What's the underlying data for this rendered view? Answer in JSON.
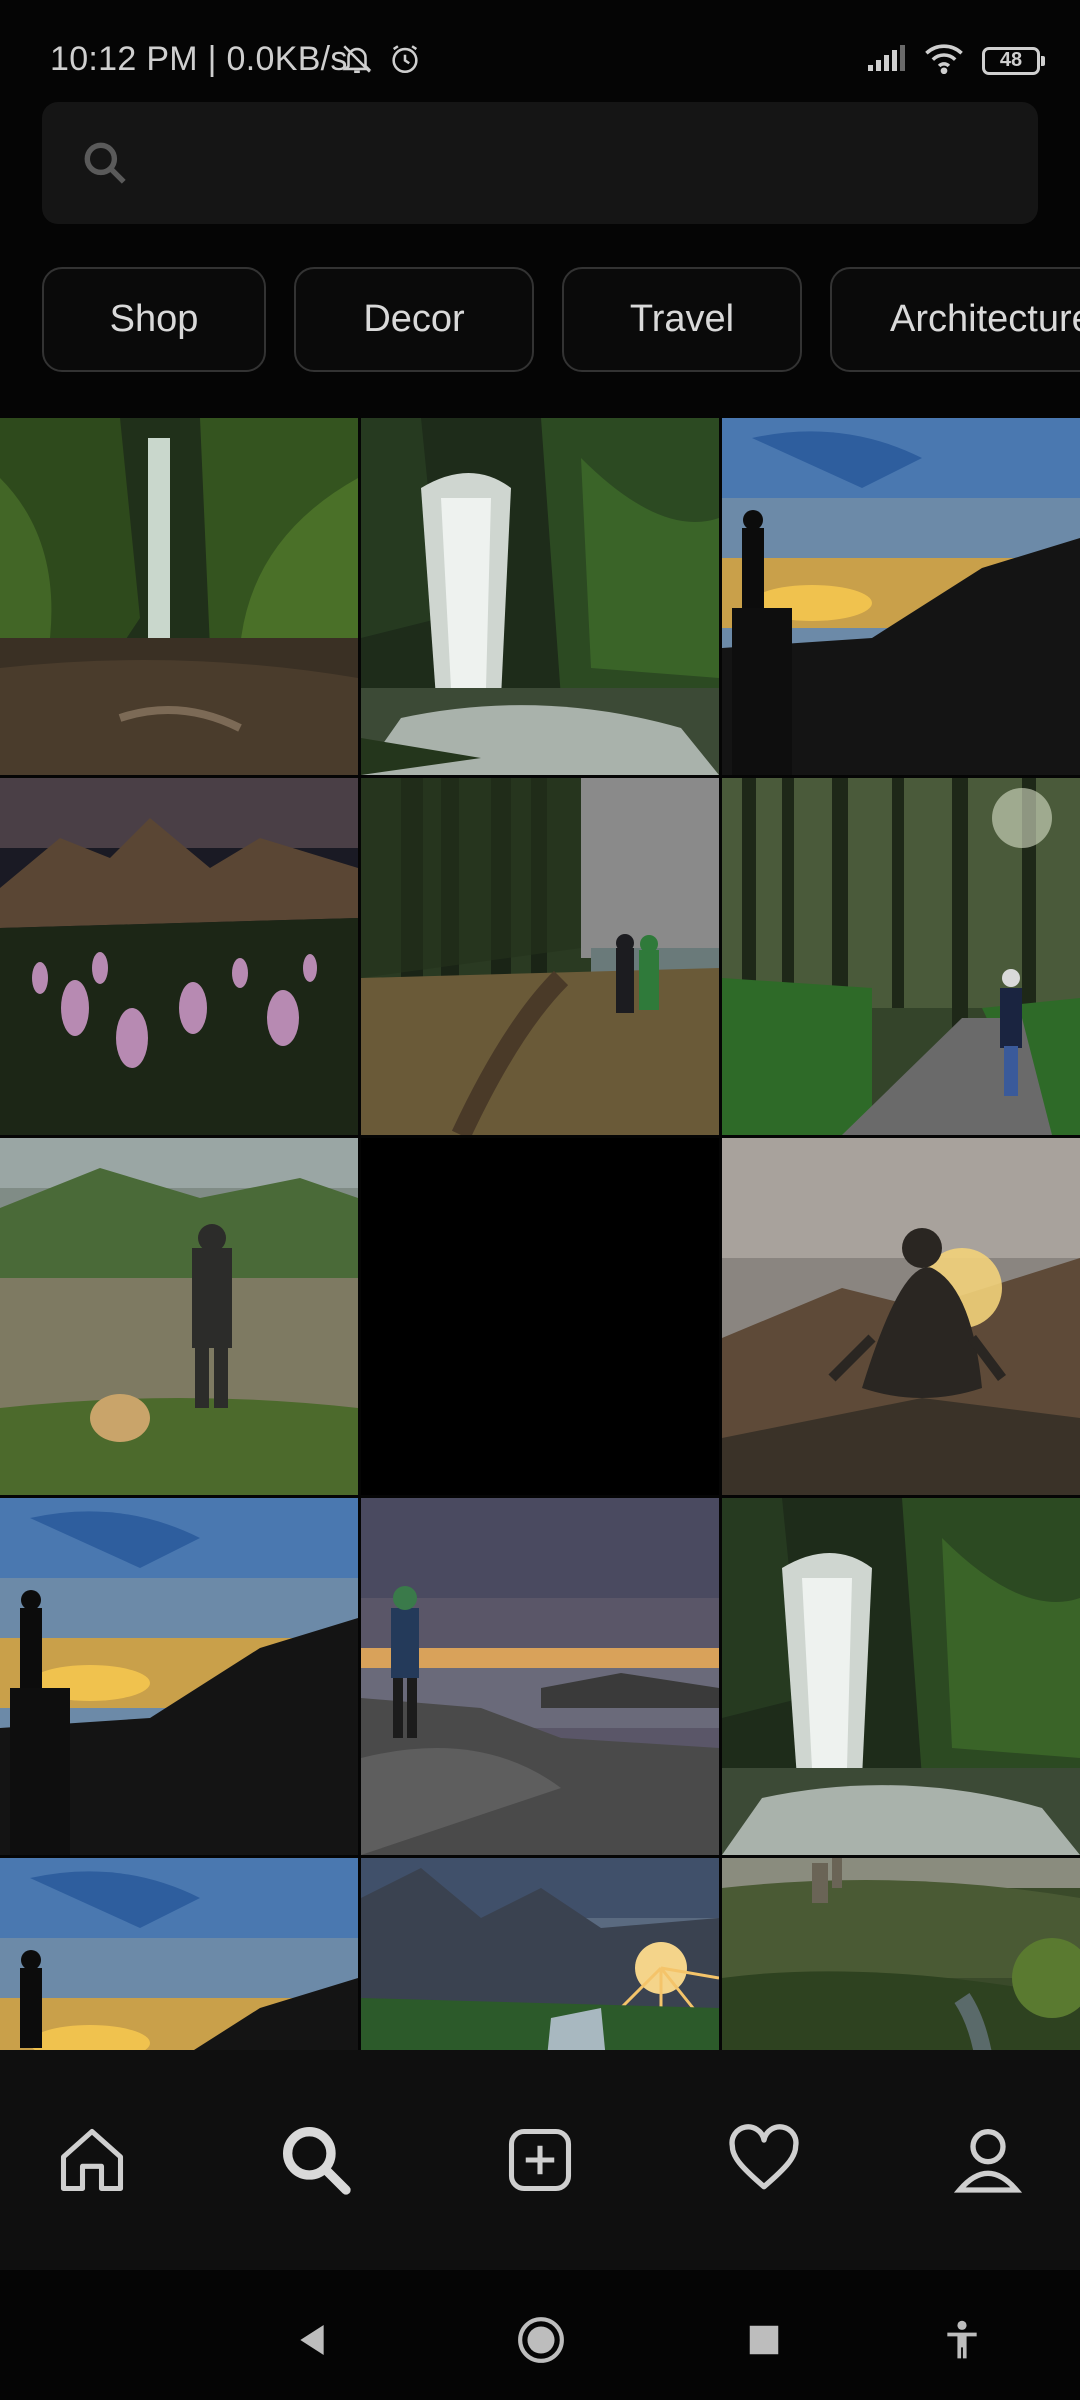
{
  "status_bar": {
    "text": "10:12 PM | 0.0KB/s",
    "battery": "48",
    "icons": [
      "mute-bell-icon",
      "alarm-icon",
      "signal-icon",
      "wifi-icon",
      "battery-icon"
    ]
  },
  "search": {
    "placeholder": "",
    "value": ""
  },
  "chips": [
    "Shop",
    "Decor",
    "Travel",
    "Architecture"
  ],
  "grid": {
    "tiles": [
      {
        "scene": "waterfall-canyon"
      },
      {
        "scene": "waterfall-forest"
      },
      {
        "scene": "sunset-silhouette"
      },
      {
        "scene": "mountain-flowers"
      },
      {
        "scene": "forest-couple-lake"
      },
      {
        "scene": "forest-path-walker"
      },
      {
        "scene": "lake-hiker-dog"
      },
      {
        "scene": "empty"
      },
      {
        "scene": "meditation-sunset"
      },
      {
        "scene": "sunset-silhouette"
      },
      {
        "scene": "coast-sunrise-hiker"
      },
      {
        "scene": "waterfall-forest"
      },
      {
        "scene": "sunset-silhouette"
      },
      {
        "scene": "mountain-sunburst"
      },
      {
        "scene": "green-valley-castle"
      }
    ]
  },
  "bottom_nav": [
    "home-icon",
    "search-icon",
    "add-post-icon",
    "heart-icon",
    "profile-icon"
  ],
  "system_nav": [
    "back-icon",
    "home-circle-icon",
    "recents-icon",
    "accessibility-icon"
  ],
  "colors": {
    "background": "#050505",
    "search_bg": "#151515",
    "nav_bg": "#0f0f0f",
    "chip_border": "#333333"
  }
}
